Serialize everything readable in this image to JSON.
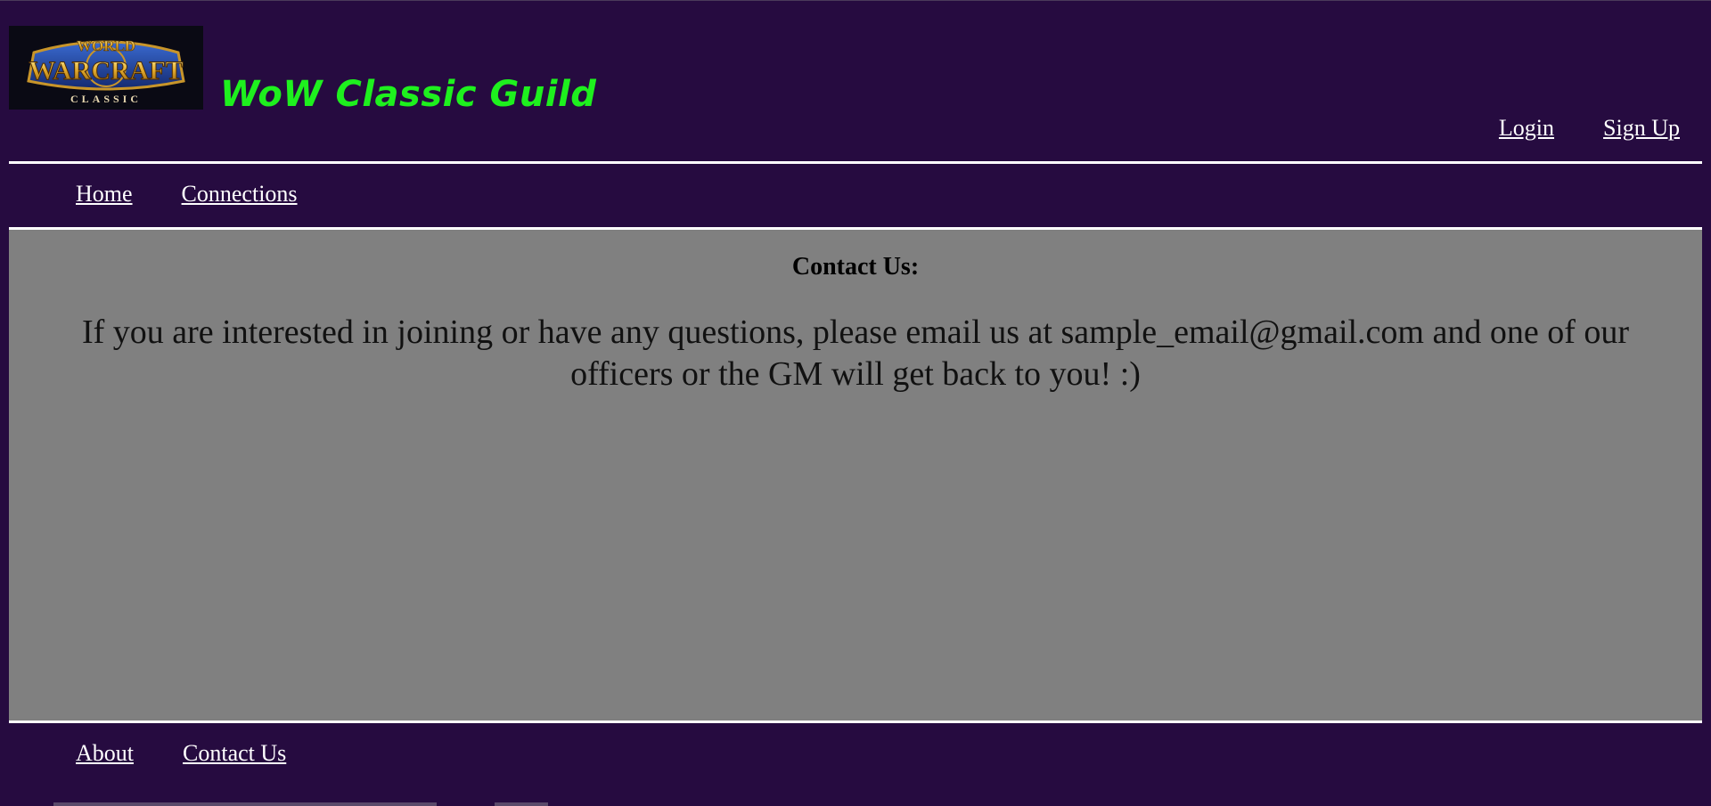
{
  "header": {
    "logo": {
      "line1": "WORLD",
      "line2": "WARCRAFT",
      "line3": "CLASSIC"
    },
    "title": "WoW Classic Guild",
    "auth_links": [
      {
        "label": "Login"
      },
      {
        "label": "Sign Up"
      }
    ]
  },
  "nav": {
    "items": [
      {
        "label": "Home"
      },
      {
        "label": "Connections"
      }
    ]
  },
  "main": {
    "heading": "Contact Us:",
    "message": "If you are interested in joining or have any questions, please email us at sample_email@gmail.com and one of our officers or the GM will get back to you! :)"
  },
  "footer": {
    "items": [
      {
        "label": "About"
      },
      {
        "label": "Contact Us"
      }
    ]
  },
  "colors": {
    "background": "#260b40",
    "title": "#1ef01e",
    "content_bg": "#808080",
    "rule": "#ffffff",
    "link": "#ffffff"
  }
}
